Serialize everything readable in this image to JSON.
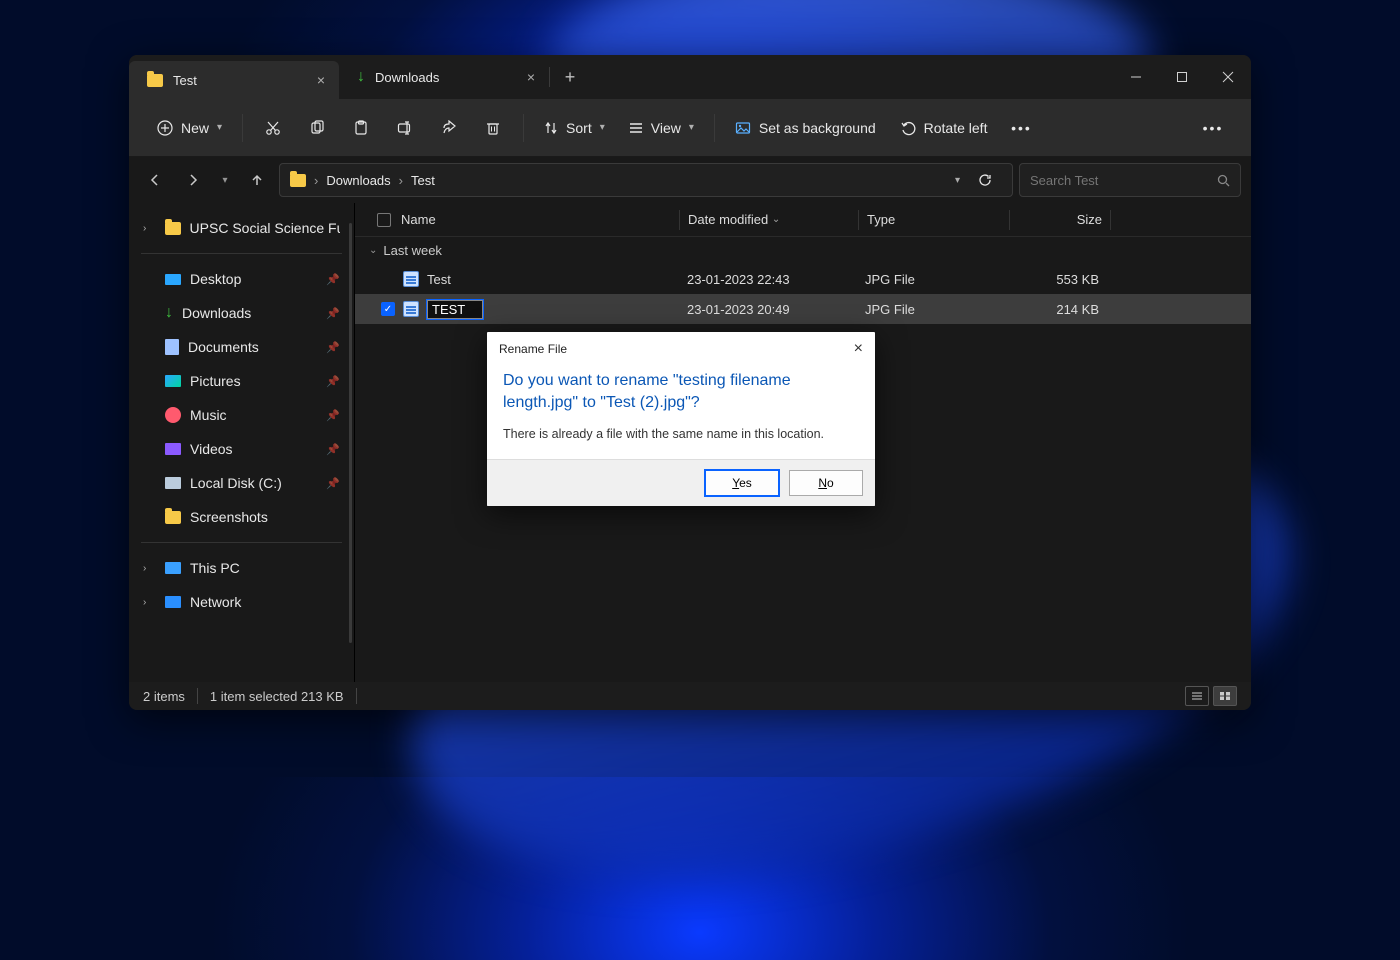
{
  "tabs": [
    {
      "label": "Test",
      "active": true
    },
    {
      "label": "Downloads",
      "active": false
    }
  ],
  "toolbar": {
    "new": "New",
    "sort": "Sort",
    "view": "View",
    "set_bg": "Set as background",
    "rotate_left": "Rotate left"
  },
  "breadcrumb": {
    "root": "Downloads",
    "leaf": "Test"
  },
  "search_placeholder": "Search Test",
  "sidebar": {
    "top": "UPSC Social Science Fu",
    "quick": [
      {
        "label": "Desktop",
        "icon": "desk",
        "pinned": true
      },
      {
        "label": "Downloads",
        "icon": "dl",
        "pinned": true
      },
      {
        "label": "Documents",
        "icon": "doc",
        "pinned": true
      },
      {
        "label": "Pictures",
        "icon": "pic",
        "pinned": true
      },
      {
        "label": "Music",
        "icon": "mus",
        "pinned": true
      },
      {
        "label": "Videos",
        "icon": "vid",
        "pinned": true
      },
      {
        "label": "Local Disk (C:)",
        "icon": "disk",
        "pinned": true
      },
      {
        "label": "Screenshots",
        "icon": "folder",
        "pinned": false
      }
    ],
    "this_pc": "This PC",
    "network": "Network"
  },
  "columns": {
    "name": "Name",
    "date": "Date modified",
    "type": "Type",
    "size": "Size"
  },
  "group_label": "Last week",
  "files": [
    {
      "name": "Test",
      "date": "23-01-2023 22:43",
      "type": "JPG File",
      "size": "553 KB",
      "selected": false,
      "editing": false
    },
    {
      "name": "TEST",
      "date": "23-01-2023 20:49",
      "type": "JPG File",
      "size": "214 KB",
      "selected": true,
      "editing": true
    }
  ],
  "dialog": {
    "title": "Rename File",
    "question": "Do you want to rename \"testing filename length.jpg\" to \"Test (2).jpg\"?",
    "message": "There is already a file with the same name in this location.",
    "yes": "Yes",
    "no": "No"
  },
  "status": {
    "items": "2 items",
    "selected": "1 item selected  213 KB"
  }
}
